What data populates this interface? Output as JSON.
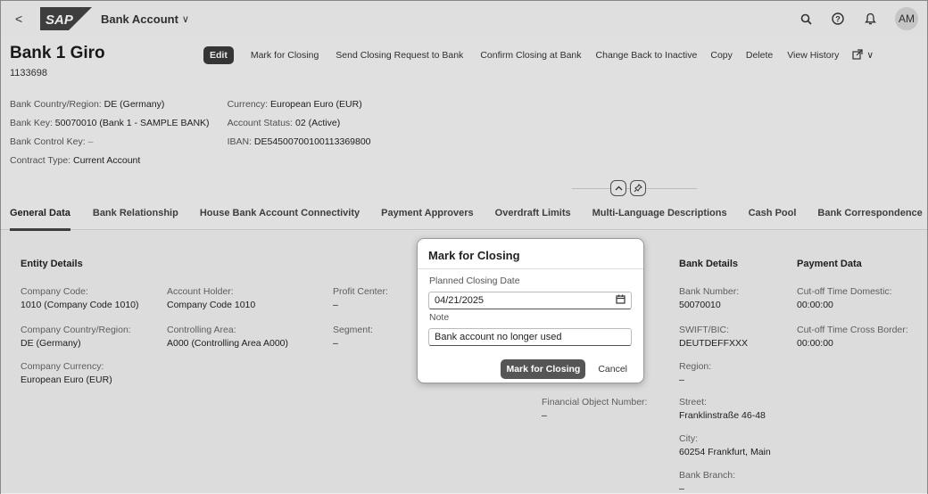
{
  "shell": {
    "back_glyph": "<",
    "logo_text": "SAP",
    "app_title": "Bank Account",
    "app_title_chevron": "∨",
    "search_glyph": "⌕",
    "help_glyph": "?",
    "bell_glyph": "♫",
    "avatar": "AM"
  },
  "header": {
    "title": "Bank 1 Giro",
    "subtitle": "1133698",
    "actions": {
      "edit": "Edit",
      "mark_for_closing": "Mark for Closing",
      "send_closing_request": "Send Closing Request to Bank",
      "confirm_closing": "Confirm Closing at Bank",
      "change_back": "Change Back to Inactive",
      "copy": "Copy",
      "delete": "Delete",
      "view_history": "View History",
      "share_glyph": "⇱",
      "share_chevron": "∨"
    },
    "col1": {
      "country_label": "Bank Country/Region:",
      "country_value": "DE (Germany)",
      "bank_key_label": "Bank Key:",
      "bank_key_value": "50070010 (Bank 1 - SAMPLE BANK)",
      "control_key_label": "Bank Control Key:",
      "control_key_value": "–",
      "contract_type_label": "Contract Type:",
      "contract_type_value": "Current Account"
    },
    "col2": {
      "currency_label": "Currency:",
      "currency_value": "European Euro (EUR)",
      "status_label": "Account Status:",
      "status_value": "02 (Active)",
      "iban_label": "IBAN:",
      "iban_value": "DE54500700100113369800"
    },
    "collapse_glyph": "⌃",
    "pin_glyph": "✎"
  },
  "tabs": [
    "General Data",
    "Bank Relationship",
    "House Bank Account Connectivity",
    "Payment Approvers",
    "Overdraft Limits",
    "Multi-Language Descriptions",
    "Cash Pool",
    "Bank Correspondence"
  ],
  "entity": {
    "title": "Entity Details",
    "company_code_label": "Company Code:",
    "company_code_value": "1010 (Company Code 1010)",
    "account_holder_label": "Account Holder:",
    "account_holder_value": "Company Code 1010",
    "profit_center_label": "Profit Center:",
    "profit_center_value": "–",
    "country_label": "Company Country/Region:",
    "country_value": "DE (Germany)",
    "controlling_area_label": "Controlling Area:",
    "controlling_area_value": "A000 (Controlling Area A000)",
    "segment_label": "Segment:",
    "segment_value": "–",
    "currency_label": "Company Currency:",
    "currency_value": "European Euro (EUR)",
    "financial_object_label": "Financial Object Number:",
    "financial_object_value": "–"
  },
  "bank_details": {
    "title": "Bank Details",
    "bank_number_label": "Bank Number:",
    "bank_number_value": "50070010",
    "swift_label": "SWIFT/BIC:",
    "swift_value": "DEUTDEFFXXX",
    "region_label": "Region:",
    "region_value": "–",
    "street_label": "Street:",
    "street_value": "Franklinstraße 46-48",
    "city_label": "City:",
    "city_value": "60254 Frankfurt, Main",
    "branch_label": "Bank Branch:",
    "branch_value": "–"
  },
  "payment_data": {
    "title": "Payment Data",
    "cutoff_domestic_label": "Cut-off Time Domestic:",
    "cutoff_domestic_value": "00:00:00",
    "cutoff_cross_label": "Cut-off Time Cross Border:",
    "cutoff_cross_value": "00:00:00"
  },
  "dialog": {
    "title": "Mark for Closing",
    "date_label": "Planned Closing Date",
    "date_value": "04/21/2025",
    "note_label": "Note",
    "note_value": "Bank account no longer used",
    "confirm": "Mark for Closing",
    "cancel": "Cancel"
  }
}
